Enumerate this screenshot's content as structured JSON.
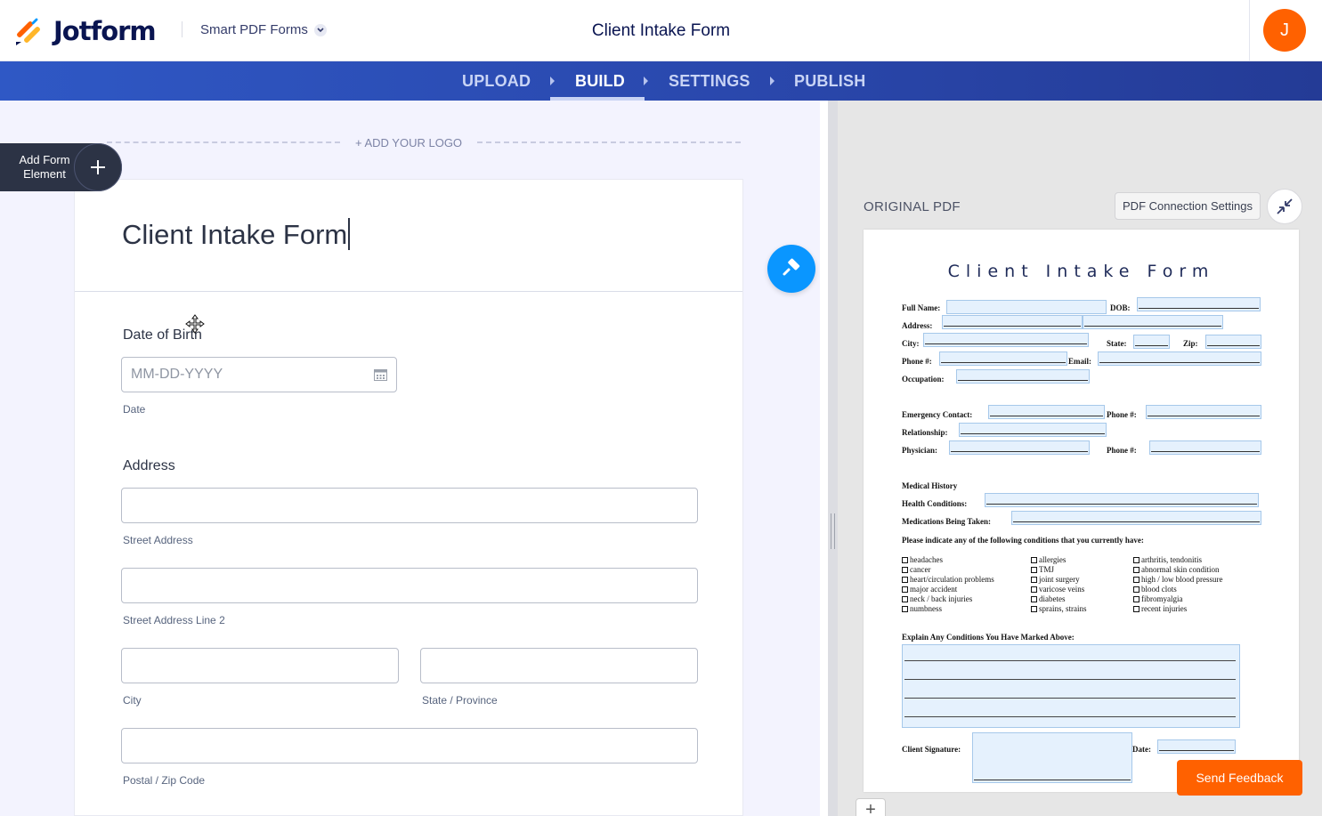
{
  "header": {
    "logo_text": "Jotform",
    "product_label": "Smart PDF Forms",
    "form_title": "Client Intake Form",
    "avatar_initial": "J",
    "avatar_color": "#ff6100"
  },
  "nav": {
    "items": [
      {
        "label": "UPLOAD",
        "active": false
      },
      {
        "label": "BUILD",
        "active": true
      },
      {
        "label": "SETTINGS",
        "active": false
      },
      {
        "label": "PUBLISH",
        "active": false
      }
    ]
  },
  "builder": {
    "add_logo_label": "+ ADD YOUR LOGO",
    "add_element_label": "Add Form Element",
    "form_heading": "Client Intake Form",
    "fields": {
      "dob_label": "Date of Birth",
      "dob_placeholder": "MM-DD-YYYY",
      "dob_sublabel": "Date",
      "address_label": "Address",
      "street_sublabel": "Street Address",
      "street2_sublabel": "Street Address Line 2",
      "city_sublabel": "City",
      "state_sublabel": "State / Province",
      "zip_sublabel": "Postal / Zip Code"
    }
  },
  "pdf_panel": {
    "label": "ORIGINAL PDF",
    "connection_button": "PDF Connection Settings",
    "title": "Client Intake Form",
    "labels": {
      "full_name": "Full Name:",
      "dob": "DOB:",
      "address": "Address:",
      "city": "City:",
      "state": "State:",
      "zip": "Zip:",
      "phone": "Phone #:",
      "email": "Email:",
      "occupation": "Occupation:",
      "emergency": "Emergency Contact:",
      "phone2": "Phone #:",
      "relationship": "Relationship:",
      "physician": "Physician:",
      "phone3": "Phone #:",
      "medical_history": "Medical History",
      "health_conditions": "Health Conditions:",
      "medications": "Medications Being Taken:",
      "conditions_prompt": "Please indicate any of the following conditions that you currently have:",
      "explain": "Explain Any Conditions You Have Marked Above:",
      "signature": "Client Signature:",
      "date": "Date:"
    },
    "conditions_col1": [
      "headaches",
      "cancer",
      "heart/circulation problems",
      "major accident",
      "neck / back injuries",
      "numbness"
    ],
    "conditions_col2": [
      "allergies",
      "TMJ",
      "joint surgery",
      "varicose veins",
      "diabetes",
      "sprains, strains"
    ],
    "conditions_col3": [
      "arthritis, tendonitis",
      "abnormal skin condition",
      "high / low blood pressure",
      "blood clots",
      "fibromyalgia",
      "recent injuries"
    ]
  },
  "feedback_button": "Send Feedback",
  "colors": {
    "brand_navy": "#0a1551",
    "accent_orange": "#ff6100",
    "nav_blue": "#2f58c5",
    "paint_blue": "#0a96ff",
    "pdf_field_fill": "#e5f1fd"
  }
}
